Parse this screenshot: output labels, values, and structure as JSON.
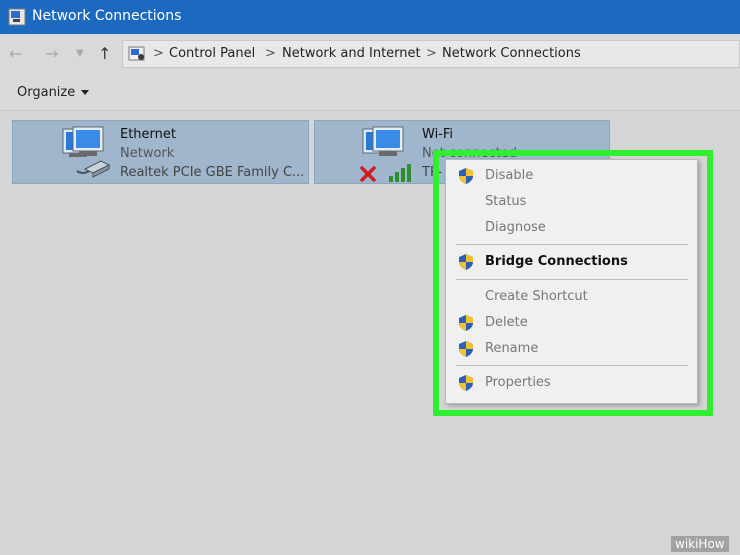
{
  "window": {
    "title": "Network Connections"
  },
  "address": {
    "crumbs": [
      "Control Panel",
      "Network and Internet",
      "Network Connections"
    ],
    "separator": ">"
  },
  "toolbar": {
    "organize_label": "Organize"
  },
  "connections": [
    {
      "name": "Ethernet",
      "status": "Network",
      "adapter": "Realtek PCIe GBE Family C..."
    },
    {
      "name": "Wi-Fi",
      "status": "Not connected",
      "adapter": "TP-"
    }
  ],
  "context_menu": {
    "items": [
      {
        "label": "Disable",
        "shield": true,
        "bold": false
      },
      {
        "label": "Status",
        "shield": false,
        "bold": false
      },
      {
        "label": "Diagnose",
        "shield": false,
        "bold": false
      },
      {
        "label": "Bridge Connections",
        "shield": true,
        "bold": true
      },
      {
        "label": "Create Shortcut",
        "shield": false,
        "bold": false
      },
      {
        "label": "Delete",
        "shield": true,
        "bold": false
      },
      {
        "label": "Rename",
        "shield": true,
        "bold": false
      },
      {
        "label": "Properties",
        "shield": true,
        "bold": false
      }
    ]
  },
  "watermark": {
    "text": "wikiHow"
  },
  "colors": {
    "titlebar": "#1c6ac0",
    "highlight": "#2ef02e",
    "tile_selected": "#9fb6cc"
  }
}
